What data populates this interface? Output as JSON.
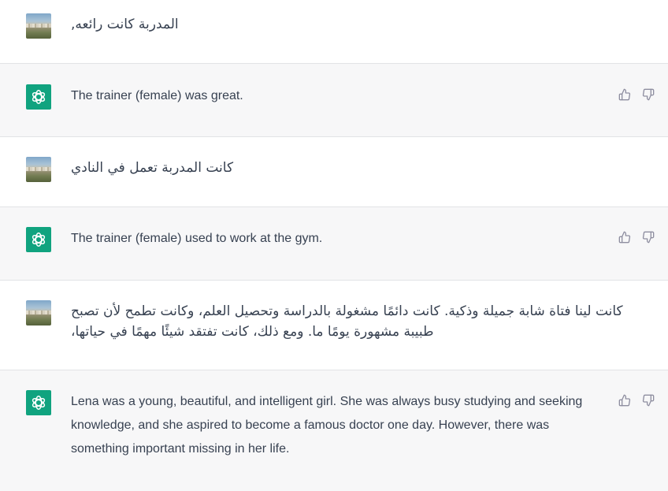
{
  "messages": [
    {
      "role": "user",
      "text": "المدربة كانت رائعه,"
    },
    {
      "role": "assistant",
      "text": "The trainer (female) was great."
    },
    {
      "role": "user",
      "text": "كانت المدربة تعمل في النادي"
    },
    {
      "role": "assistant",
      "text": "The trainer (female) used to work at the gym."
    },
    {
      "role": "user",
      "line1": "كانت لينا فتاة شابة جميلة وذكية. كانت دائمًا مشغولة بالدراسة وتحصيل العلم، وكانت تطمح لأن تصبح",
      "line2": "طبيبة مشهورة يومًا ما. ومع ذلك، كانت تفتقد شيئًا مهمًا في حياتها،"
    },
    {
      "role": "assistant",
      "text": "Lena was a young, beautiful, and intelligent girl. She was always busy studying and seeking knowledge, and she aspired to become a famous doctor one day. However, there was something important missing in her life."
    }
  ],
  "icons": {
    "user_avatar": "user-avatar-photo",
    "assistant_avatar": "chatgpt-logo-icon",
    "thumbs_up": "thumbs-up-icon",
    "thumbs_down": "thumbs-down-icon"
  },
  "colors": {
    "assistant_bg": "#f7f7f8",
    "logo_green": "#10a37f",
    "text": "#374151",
    "icon": "#8e8ea0"
  }
}
